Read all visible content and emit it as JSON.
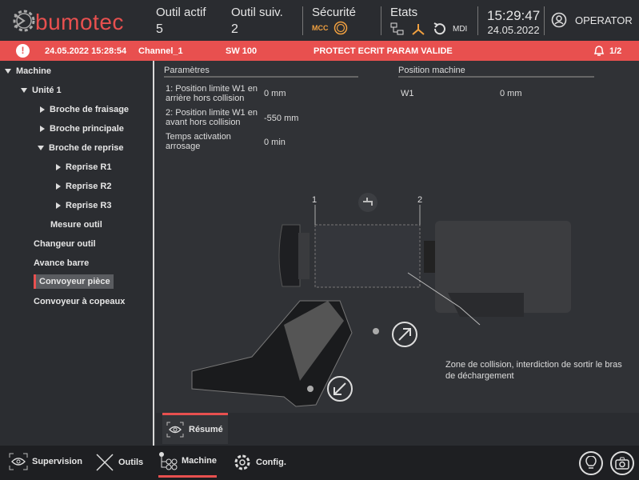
{
  "header": {
    "brand": "bumotec",
    "active_tool_label": "Outil actif",
    "active_tool": "5",
    "next_tool_label": "Outil suiv.",
    "next_tool": "2",
    "security_label": "Sécurité",
    "security_mcc": "MCC",
    "states_label": "Etats",
    "mode": "MDI",
    "time": "15:29:47",
    "date": "24.05.2022",
    "user": "OPERATOR"
  },
  "alarm": {
    "timestamp": "24.05.2022 15:28:54",
    "channel": "Channel_1",
    "code": "SW 100",
    "message": "PROTECT ECRIT PARAM VALIDE",
    "count": "1/2",
    "color": "#e8504f"
  },
  "tree": {
    "items": [
      {
        "label": "Machine"
      },
      {
        "label": "Unité 1"
      },
      {
        "label": "Broche de fraisage"
      },
      {
        "label": "Broche principale"
      },
      {
        "label": "Broche de reprise"
      },
      {
        "label": "Reprise R1"
      },
      {
        "label": "Reprise R2"
      },
      {
        "label": "Reprise R3"
      },
      {
        "label": "Mesure outil"
      },
      {
        "label": "Changeur outil"
      },
      {
        "label": "Avance barre"
      },
      {
        "label": "Convoyeur pièce"
      },
      {
        "label": "Convoyeur à copeaux"
      }
    ]
  },
  "params": {
    "title": "Paramètres",
    "rows": [
      {
        "label": "1: Position limite W1 en arrière hors collision",
        "value": "0 mm"
      },
      {
        "label": "2: Position limite W1 en avant hors collision",
        "value": "-550 mm"
      },
      {
        "label": "Temps activation arrosage",
        "value": "0 min"
      }
    ]
  },
  "position": {
    "title": "Position machine",
    "axis": "W1",
    "value": "0 mm"
  },
  "diagram": {
    "marker1": "1",
    "marker2": "2",
    "note": "Zone de collision, interdiction de sortir le bras de déchargement"
  },
  "tabs": {
    "resume": "Résumé"
  },
  "nav": {
    "supervision": "Supervision",
    "outils": "Outils",
    "machine": "Machine",
    "config": "Config."
  }
}
